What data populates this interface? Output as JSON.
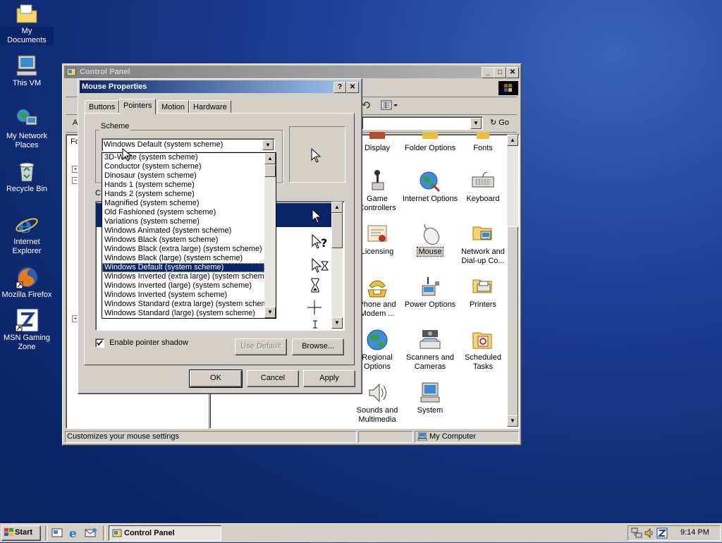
{
  "desktop": {
    "icons": [
      {
        "label": "My Documents",
        "icon": "folder-documents-icon"
      },
      {
        "label": "This VM",
        "icon": "computer-icon"
      },
      {
        "label": "My Network Places",
        "icon": "network-places-icon"
      },
      {
        "label": "Recycle Bin",
        "icon": "recycle-bin-icon"
      },
      {
        "label": "Internet Explorer",
        "icon": "internet-explorer-icon"
      },
      {
        "label": "Mozilla Firefox",
        "icon": "firefox-icon"
      },
      {
        "label": "MSN Gaming Zone",
        "icon": "msn-gaming-zone-icon"
      }
    ]
  },
  "control_panel": {
    "title": "Control Panel",
    "go_label": "Go",
    "address_partial": "A",
    "folders_partial": "Fo",
    "items": [
      {
        "label": "Display",
        "icon": "display-icon"
      },
      {
        "label": "Folder Options",
        "icon": "folder-options-icon"
      },
      {
        "label": "Fonts",
        "icon": "fonts-icon"
      },
      {
        "label": "Game Controllers",
        "icon": "game-controller-icon"
      },
      {
        "label": "Internet Options",
        "icon": "internet-options-icon"
      },
      {
        "label": "Keyboard",
        "icon": "keyboard-icon"
      },
      {
        "label": "Licensing",
        "icon": "licensing-icon"
      },
      {
        "label": "Mouse",
        "icon": "mouse-icon"
      },
      {
        "label": "Network and Dial-up Co...",
        "icon": "network-dialup-icon"
      },
      {
        "label": "Phone and Modem ...",
        "icon": "phone-modem-icon"
      },
      {
        "label": "Power Options",
        "icon": "power-options-icon"
      },
      {
        "label": "Printers",
        "icon": "printers-icon"
      },
      {
        "label": "Regional Options",
        "icon": "regional-options-icon"
      },
      {
        "label": "Scanners and Cameras",
        "icon": "scanners-cameras-icon"
      },
      {
        "label": "Scheduled Tasks",
        "icon": "scheduled-tasks-icon"
      },
      {
        "label": "Sounds and Multimedia",
        "icon": "sounds-multimedia-icon"
      },
      {
        "label": "System",
        "icon": "system-icon"
      }
    ],
    "status_left": "Customizes your mouse settings",
    "status_right": "My Computer"
  },
  "mouse_properties": {
    "title": "Mouse Properties",
    "tabs": [
      "Buttons",
      "Pointers",
      "Motion",
      "Hardware"
    ],
    "selected_tab": "Pointers",
    "scheme_label": "Scheme",
    "customize_partial": "C",
    "scheme_selected": "Windows Default (system scheme)",
    "scheme_options": [
      "3D-White (system scheme)",
      "Conductor (system scheme)",
      "Dinosaur (system scheme)",
      "Hands 1 (system scheme)",
      "Hands 2 (system scheme)",
      "Magnified (system scheme)",
      "Old Fashioned (system scheme)",
      "Variations (system scheme)",
      "Windows Animated (system scheme)",
      "Windows Black  (system scheme)",
      "Windows Black (extra large) (system scheme)",
      "Windows Black (large) (system scheme)",
      "Windows Default (system scheme)",
      "Windows Inverted (extra large) (system scheme)",
      "Windows Inverted (large) (system scheme)",
      "Windows Inverted (system scheme)",
      "Windows Standard (extra large) (system scheme)",
      "Windows Standard (large) (system scheme)"
    ],
    "enable_shadow_label": "Enable pointer shadow",
    "enable_shadow_checked": true,
    "use_default_label": "Use Default",
    "browse_label": "Browse...",
    "ok_label": "OK",
    "cancel_label": "Cancel",
    "apply_label": "Apply"
  },
  "taskbar": {
    "start_label": "Start",
    "task_label": "Control Panel",
    "time": "9:14 PM"
  },
  "colors": {
    "selection": "#0a246a",
    "face": "#d4d0c8",
    "desktop": "#1c3f93"
  }
}
